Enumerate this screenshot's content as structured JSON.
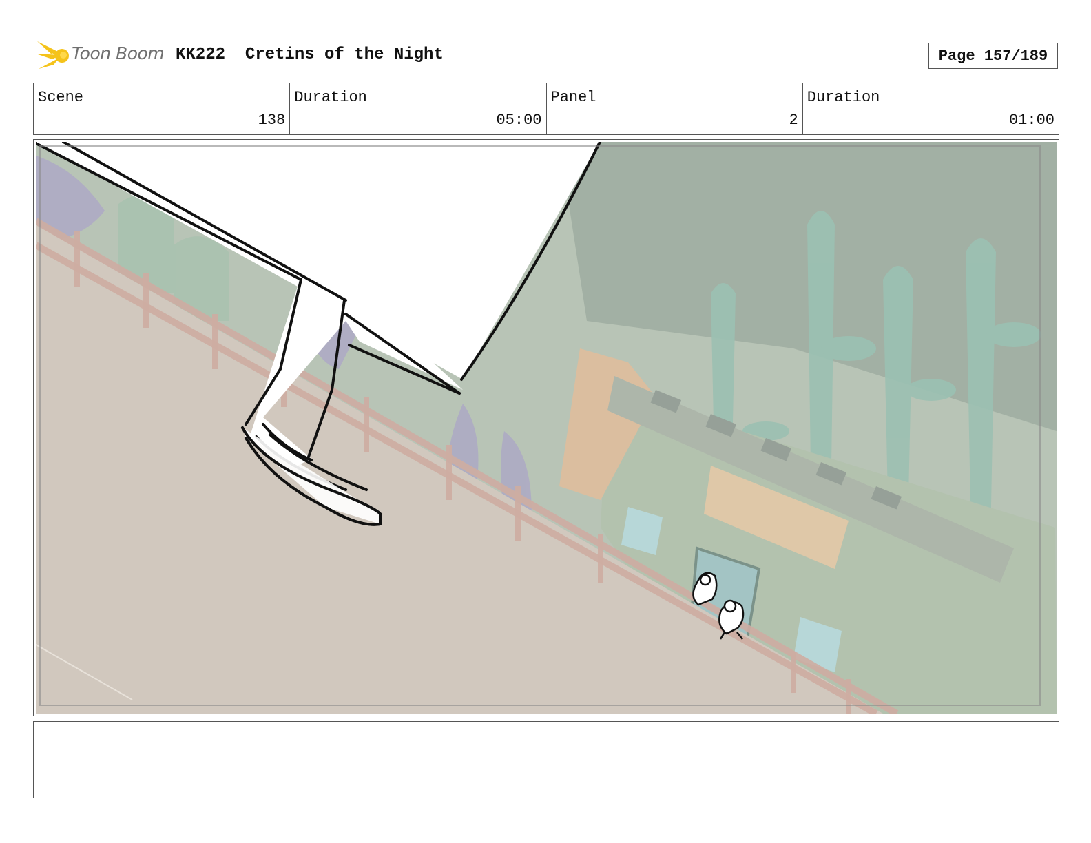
{
  "header": {
    "logo_text": "Toon Boom",
    "title": "KK222  Cretins of the Night",
    "page": "Page 157/189"
  },
  "info": {
    "scene_label": "Scene",
    "scene_value": "138",
    "scene_duration_label": "Duration",
    "scene_duration_value": "05:00",
    "panel_label": "Panel",
    "panel_value": "2",
    "panel_duration_label": "Duration",
    "panel_duration_value": "01:00"
  },
  "notes": {
    "text": ""
  },
  "colors": {
    "logo_flame": "#f5c31a",
    "frame_border": "#555555",
    "ground": "#c7bcb0",
    "foliage": "#8fae9e",
    "house": "#9fb39a"
  }
}
